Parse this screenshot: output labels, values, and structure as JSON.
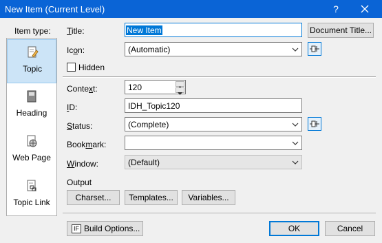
{
  "window": {
    "title": "New Item (Current Level)",
    "help_label": "?",
    "close_icon": "close-icon"
  },
  "sidebar": {
    "heading": "Item type:",
    "items": [
      {
        "label": "Topic",
        "icon": "topic-icon",
        "selected": true
      },
      {
        "label": "Heading",
        "icon": "heading-book-icon",
        "selected": false
      },
      {
        "label": "Web Page",
        "icon": "web-page-icon",
        "selected": false
      },
      {
        "label": "Topic Link",
        "icon": "topic-link-icon",
        "selected": false
      }
    ]
  },
  "form": {
    "title_label": "Title:",
    "title_value": "New Item",
    "document_title_button": "Document Title...",
    "icon_label": "Icon:",
    "icon_value": "(Automatic)",
    "hidden_label": "Hidden",
    "hidden_checked": false,
    "context_label": "Context:",
    "context_value": "120",
    "id_label": "ID:",
    "id_value": "IDH_Topic120",
    "status_label": "Status:",
    "status_value": "(Complete)",
    "bookmark_label": "Bookmark:",
    "bookmark_value": "",
    "window_label": "Window:",
    "window_value": "(Default)"
  },
  "output": {
    "heading": "Output",
    "charset_button": "Charset...",
    "templates_button": "Templates...",
    "variables_button": "Variables..."
  },
  "footer": {
    "build_options_icon_text": "IF",
    "build_options_button": "Build Options...",
    "ok_button": "OK",
    "cancel_button": "Cancel"
  },
  "colors": {
    "titlebar": "#0a64d6",
    "selection": "#0078d7",
    "sidebar_selected": "#cce4f7"
  }
}
